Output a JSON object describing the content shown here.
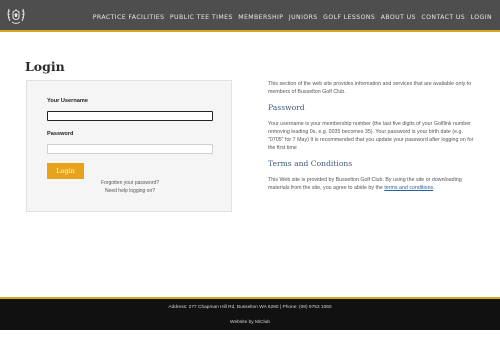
{
  "header": {
    "logo_icon": "club-crest-icon",
    "accent_color": "#d8a722",
    "nav": [
      "PRACTICE FACILITIES",
      "PUBLIC TEE TIMES",
      "MEMBERSHIP",
      "JUNIORS",
      "GOLF LESSONS",
      "ABOUT US",
      "CONTACT US",
      "LOGIN"
    ]
  },
  "page": {
    "title": "Login"
  },
  "login": {
    "username_label": "Your Username",
    "username_value": "",
    "password_label": "Password",
    "password_value": "",
    "button_label": "Login",
    "button_color": "#e8a21c",
    "forgot_link": "Forgotten your password?",
    "help_link": "Need help logging on?"
  },
  "info": {
    "intro": "This section of the web site provides information and services that are available only to members of Busselton Golf Club.",
    "password_heading": "Password",
    "password_text": "Your username is your membership number (the last five digits of your Golflink number removing leading 0s, e.g. 0035 becomes 35). Your password is your birth date (e.g. \"0705\" for 7 May) It is recommended that you update your password after logging on for the first time",
    "terms_heading": "Terms and Conditions",
    "terms_text": "This Web site is provided by Busselton Golf Club. By using the site or downloading materials from the site, you agree to abide by the",
    "terms_link": "terms and conditions",
    "terms_end": "."
  },
  "footer": {
    "address": "Address: 277 Chapman Hill Rd, Busselton WA 6280 | Phone: (08) 9753 1050",
    "credit": "Website by MiClub"
  }
}
